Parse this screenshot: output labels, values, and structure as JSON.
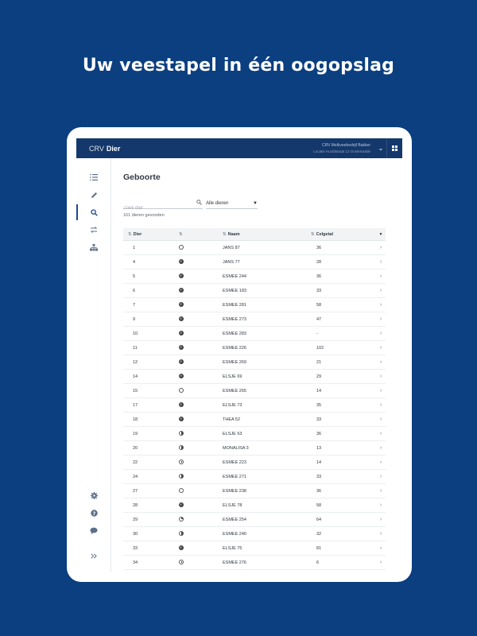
{
  "headline": "Uw veestapel in één oogopslag",
  "app": {
    "brand_prefix": "CRV",
    "brand_name": "Dier",
    "account_line1": "CRV Melkveebedrijf Bakker",
    "account_line2": "Locatie Hoofdstraat 12 Oosterwolde"
  },
  "page": {
    "title": "Geboorte",
    "search_placeholder": "Zoek dier",
    "filter_value": "Alle dieren",
    "result_count": "161 dieren gevonden"
  },
  "table": {
    "columns": {
      "dier": "Dier",
      "icon": "",
      "naam": "Naam",
      "celgetal": "Celgetal"
    },
    "rows": [
      {
        "dier": "1",
        "status": "empty",
        "naam": "JANS 87",
        "celgetal": "36"
      },
      {
        "dier": "4",
        "status": "full",
        "naam": "JANS 77",
        "celgetal": "28"
      },
      {
        "dier": "5",
        "status": "full",
        "naam": "ESMEE 244",
        "celgetal": "36"
      },
      {
        "dier": "6",
        "status": "full",
        "naam": "ESMEE 183",
        "celgetal": "33"
      },
      {
        "dier": "7",
        "status": "full",
        "naam": "ESMEE 281",
        "celgetal": "58"
      },
      {
        "dier": "9",
        "status": "full",
        "naam": "ESMEE 273",
        "celgetal": "47"
      },
      {
        "dier": "10",
        "status": "full",
        "naam": "ESMEE 283",
        "celgetal": "-"
      },
      {
        "dier": "11",
        "status": "full",
        "naam": "ESMEE 226",
        "celgetal": "102"
      },
      {
        "dier": "12",
        "status": "full",
        "naam": "ESMEE 269",
        "celgetal": "21"
      },
      {
        "dier": "14",
        "status": "full",
        "naam": "ELSJE 69",
        "celgetal": "29"
      },
      {
        "dier": "15",
        "status": "empty",
        "naam": "ESMEE 265",
        "celgetal": "14"
      },
      {
        "dier": "17",
        "status": "full",
        "naam": "ELSJE 73",
        "celgetal": "35"
      },
      {
        "dier": "18",
        "status": "full",
        "naam": "THEA 52",
        "celgetal": "33"
      },
      {
        "dier": "19",
        "status": "half",
        "naam": "ELSJE 63",
        "celgetal": "36"
      },
      {
        "dier": "20",
        "status": "half",
        "naam": "MONALISA 3",
        "celgetal": "13"
      },
      {
        "dier": "22",
        "status": "clock",
        "naam": "ESMEE 223",
        "celgetal": "14"
      },
      {
        "dier": "24",
        "status": "half",
        "naam": "ESMEE 271",
        "celgetal": "33"
      },
      {
        "dier": "27",
        "status": "empty",
        "naam": "ESMEE 238",
        "celgetal": "36"
      },
      {
        "dier": "28",
        "status": "full",
        "naam": "ELSJE 78",
        "celgetal": "58"
      },
      {
        "dier": "29",
        "status": "quarter",
        "naam": "ESMEE 254",
        "celgetal": "64"
      },
      {
        "dier": "30",
        "status": "half",
        "naam": "ESMEE 240",
        "celgetal": "32"
      },
      {
        "dier": "33",
        "status": "full",
        "naam": "ELSJE 75",
        "celgetal": "81"
      },
      {
        "dier": "34",
        "status": "clock",
        "naam": "ESMEE 276",
        "celgetal": "6"
      }
    ]
  },
  "colors": {
    "background": "#0b3f80",
    "topbar": "#14386c",
    "accent": "#1b4a8c"
  },
  "icons": {
    "sidebar": [
      "list-icon",
      "pencil-icon",
      "search-icon",
      "transfer-icon",
      "herd-icon",
      "gear-icon",
      "help-icon",
      "chat-icon",
      "expand-icon"
    ]
  }
}
